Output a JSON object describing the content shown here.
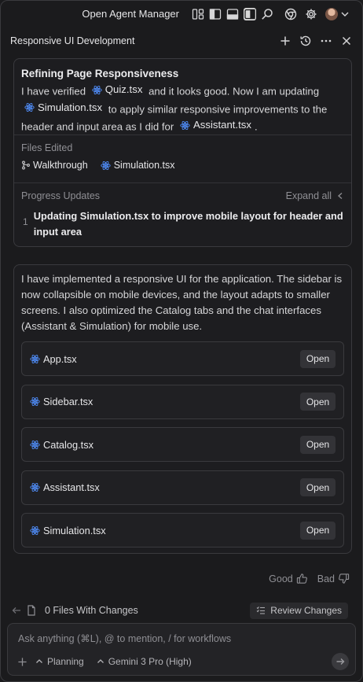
{
  "topbar": {
    "app_title": "Open Agent Manager"
  },
  "header": {
    "title": "Responsive UI Development"
  },
  "task_card": {
    "title": "Refining Page Responsiveness",
    "desc": {
      "p1": "I have verified",
      "file1": "Quiz.tsx",
      "p2": "and it looks good. Now I am updating",
      "file2": "Simulation.tsx",
      "p3": "to apply similar responsive improvements to the header and input area as I did for",
      "file3": "Assistant.tsx",
      "p4": "."
    },
    "files_edited_label": "Files Edited",
    "files_edited": [
      "Walkthrough",
      "Simulation.tsx"
    ],
    "progress_label": "Progress Updates",
    "expand_all": "Expand all",
    "steps": [
      {
        "num": "1",
        "text": "Updating Simulation.tsx to improve mobile layout for header and input area"
      }
    ]
  },
  "summary_card": {
    "text": "I have implemented a responsive UI for the application. The sidebar is now collapsible on mobile devices, and the layout adapts to smaller screens. I also optimized the Catalog tabs and the chat interfaces (Assistant & Simulation) for mobile use.",
    "open_label": "Open",
    "files": [
      "App.tsx",
      "Sidebar.tsx",
      "Catalog.tsx",
      "Assistant.tsx",
      "Simulation.tsx"
    ]
  },
  "feedback": {
    "good": "Good",
    "bad": "Bad"
  },
  "changes": {
    "text": "0 Files With Changes",
    "review": "Review Changes"
  },
  "input": {
    "placeholder": "Ask anything (⌘L), @ to mention, / for workflows",
    "mode": "Planning",
    "model": "Gemini 3 Pro (High)"
  },
  "colors": {
    "background": "#1b1b1d",
    "card": "#1d1d20",
    "border": "#3a3a3e",
    "react_icon": "#4f8cf7",
    "muted_text": "#8f8f94"
  }
}
